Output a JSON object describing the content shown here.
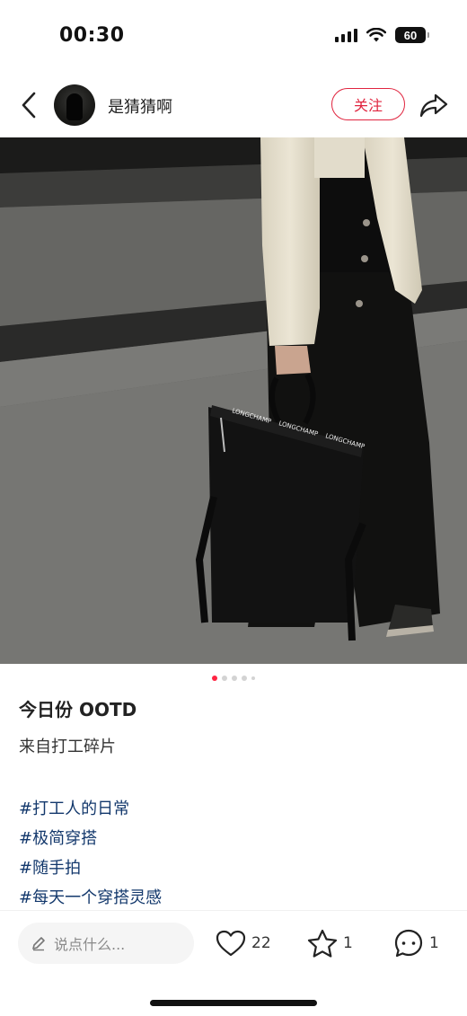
{
  "status_bar": {
    "time": "00:30",
    "battery": "60",
    "icons": [
      "signal-icon",
      "wifi-icon",
      "battery-icon"
    ]
  },
  "header": {
    "back_icon": "chevron-left-icon",
    "username": "是猜猜啊",
    "follow_label": "关注",
    "share_icon": "share-icon"
  },
  "gallery": {
    "total_pages": 5,
    "current_page": 1,
    "bag_text": "LONGCHAMP"
  },
  "post": {
    "title": "今日份 OOTD",
    "body": "来自打工碎片",
    "tags": [
      "#打工人的日常",
      "#极简穿搭",
      "#随手拍",
      "#每天一个穿搭灵感"
    ]
  },
  "bottom_bar": {
    "comment_placeholder": "说点什么...",
    "likes": "22",
    "stars": "1",
    "comments": "1"
  },
  "colors": {
    "accent": "#ff2442",
    "follow": "#e0253f",
    "tag": "#13386c"
  }
}
